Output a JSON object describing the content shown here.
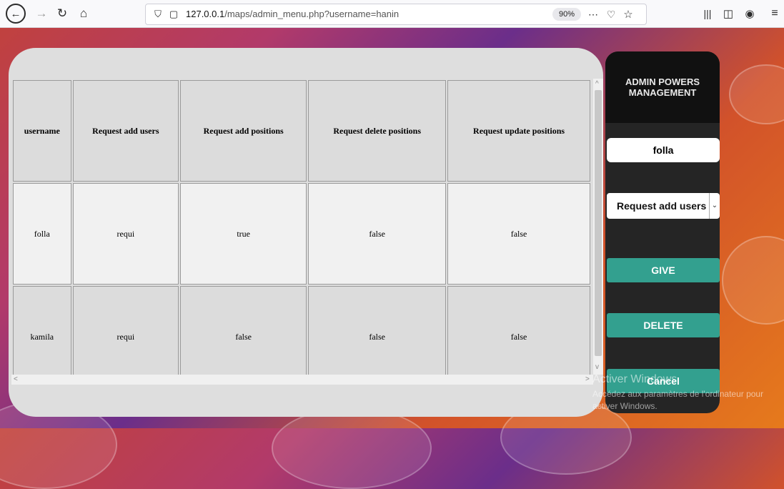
{
  "browser": {
    "url_prefix": "127.0.0.1",
    "url_rest": "/maps/admin_menu.php?username=hanin",
    "zoom": "90%"
  },
  "table": {
    "headers": [
      "username",
      "Request add users",
      "Request add positions",
      "Request delete positions",
      "Request update positions"
    ],
    "rows": [
      [
        "folla",
        "requi",
        "true",
        "false",
        "false"
      ],
      [
        "kamila",
        "requi",
        "false",
        "false",
        "false"
      ]
    ]
  },
  "side_panel": {
    "title": "ADMIN POWERS MANAGEMENT",
    "username_value": "folla",
    "power_select": "Request add users",
    "give_label": "GIVE",
    "delete_label": "DELETE",
    "cancel_label": "Cancel"
  },
  "watermark": {
    "line1": "Activer Windows",
    "line2": "Accédez aux paramètres de l'ordinateur pour",
    "line3": "activer Windows."
  },
  "colors": {
    "button_accent": "#33a08f",
    "panel_bg": "#dedede",
    "side_bg": "#252525"
  }
}
